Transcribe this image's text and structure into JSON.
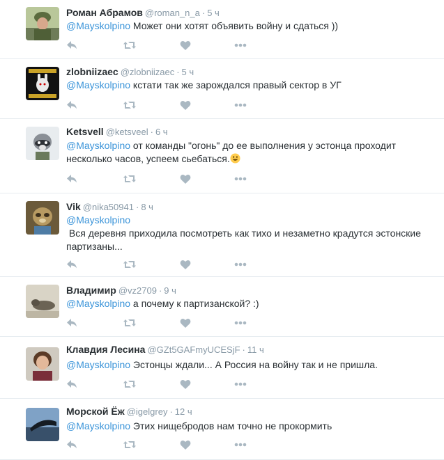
{
  "colors": {
    "name": "#292f33",
    "meta": "#8899a6",
    "mention": "#3b94d9",
    "action_icon": "#aab8c2",
    "divider": "#e6ecf0"
  },
  "icons": {
    "reply": "reply-icon",
    "retweet": "retweet-icon",
    "like": "heart-icon",
    "more": "more-dots-icon"
  },
  "tweets": [
    {
      "name": "Роман Абрамов",
      "handle": "@roman_n_a",
      "time": "5 ч",
      "mention": "@Mayskolpino",
      "text": " Может они хотят объявить войну и сдаться ))"
    },
    {
      "name": "zlobniizaec",
      "handle": "@zlobniizaec",
      "time": "5 ч",
      "mention": "@Mayskolpino",
      "text": " кстати так же зарождался правый сектор в УГ"
    },
    {
      "name": "Ketsvell",
      "handle": "@ketsveel",
      "time": "6 ч",
      "mention": "@Mayskolpino",
      "text": " от команды \"огонь\" до ее выполнения у эстонца проходит несколько часов, успеем сьебаться.",
      "emoji": "grinning-face"
    },
    {
      "name": "Vik",
      "handle": "@nika50941",
      "time": "8 ч",
      "mention": "@Mayskolpino",
      "text": "\n Вся деревня приходила посмотреть как тихо и незаметно крадутся эстонские партизаны..."
    },
    {
      "name": "Владимир",
      "handle": "@vz2709",
      "time": "9 ч",
      "mention": "@Mayskolpino",
      "text": " а почему к партизанской? :)"
    },
    {
      "name": "Клавдия Лесина",
      "handle": "@GZt5GAFmyUCESjF",
      "time": "11 ч",
      "mention": "@Mayskolpino",
      "text": " Эстонцы ждали... А Россия на войну так и не пришла."
    },
    {
      "name": "Морской Ёж",
      "handle": "@igelgrey",
      "time": "12 ч",
      "mention": "@Mayskolpino",
      "text": " Этих нищебродов нам точно не прокормить"
    }
  ]
}
